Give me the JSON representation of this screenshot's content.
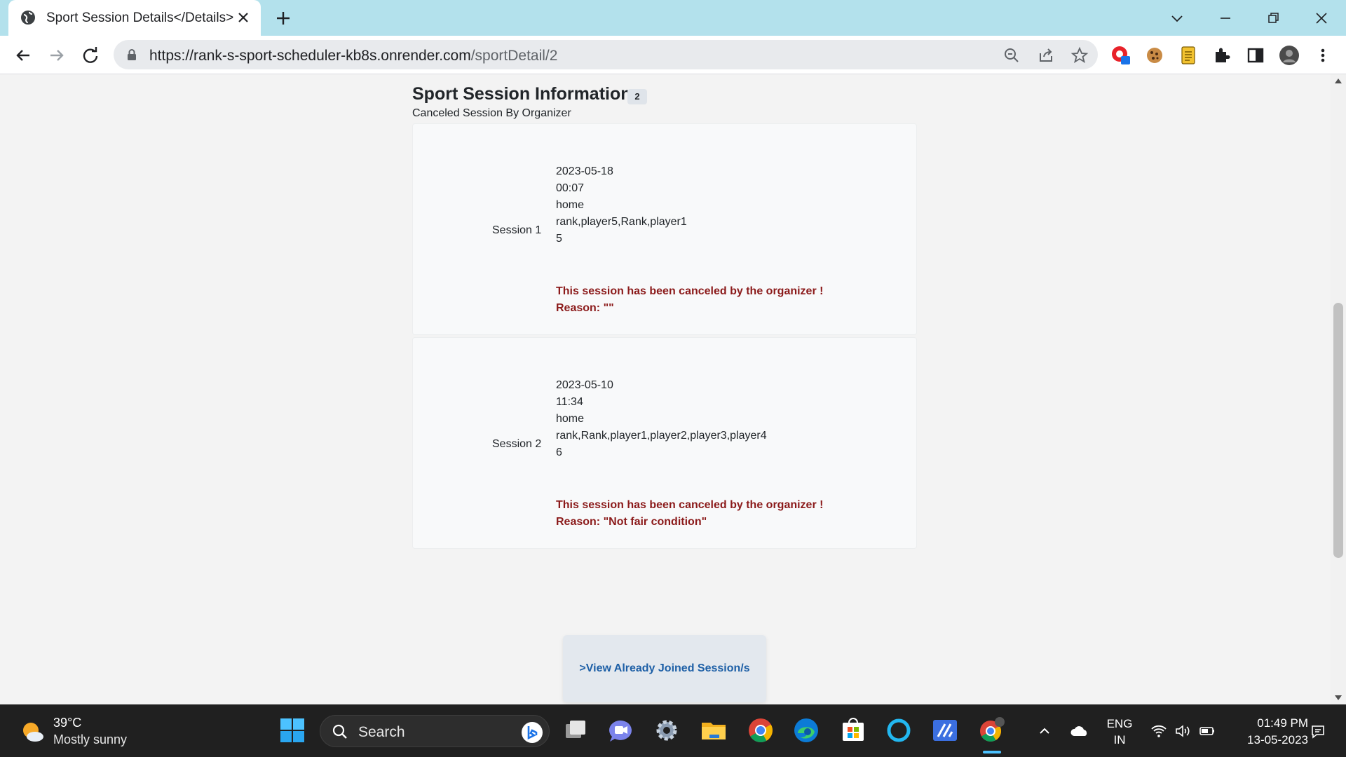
{
  "browser": {
    "tab_title": "Sport Session Details</Details>",
    "url_host": "https://rank-s-sport-scheduler-kb8s.onrender.com",
    "url_path": "/sportDetail/2"
  },
  "page": {
    "title": "Sport Session Information",
    "count_badge": "2",
    "subtitle": "Canceled Session By Organizer",
    "sessions": [
      {
        "label": "Session 1",
        "date": "2023-05-18",
        "time": "00:07",
        "venue": "home",
        "players": "rank,player5,Rank,player1",
        "count": "5",
        "cancel_message": "This session has been canceled by the organizer !",
        "reason": "Reason: \"\""
      },
      {
        "label": "Session 2",
        "date": "2023-05-10",
        "time": "11:34",
        "venue": "home",
        "players": "rank,Rank,player1,player2,player3,player4",
        "count": "6",
        "cancel_message": "This session has been canceled by the organizer !",
        "reason": "Reason: \"Not fair condition\""
      }
    ],
    "joined_button": ">View Already Joined Session/s"
  },
  "taskbar": {
    "weather_temp": "39°C",
    "weather_desc": "Mostly sunny",
    "search_placeholder": "Search",
    "lang_top": "ENG",
    "lang_bottom": "IN",
    "time": "01:49 PM",
    "date": "13-05-2023"
  },
  "colors": {
    "tabstrip": "#b3e1ec",
    "cancel_text": "#8b1a1a",
    "link_text": "#1d5fa6"
  }
}
